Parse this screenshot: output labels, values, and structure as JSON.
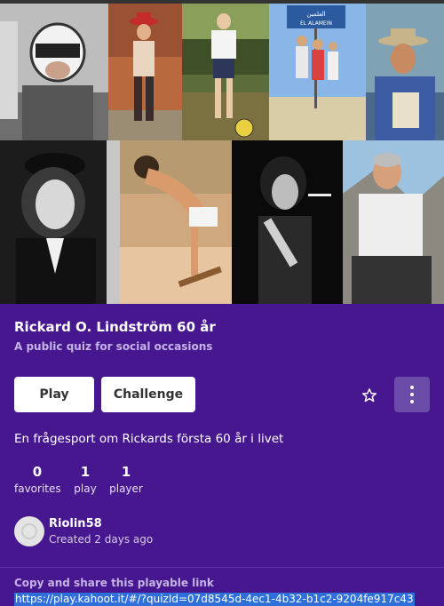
{
  "collage": {
    "photos": [
      {
        "name": "helmet-child"
      },
      {
        "name": "cowboy-child"
      },
      {
        "name": "football-boy"
      },
      {
        "name": "el-alamein-sign"
      },
      {
        "name": "hat-man"
      },
      {
        "name": "cap-portrait"
      },
      {
        "name": "skateboarder"
      },
      {
        "name": "cigarette-portrait"
      },
      {
        "name": "mountain-man"
      }
    ],
    "sign_text": "EL ALAMEIN"
  },
  "quiz": {
    "title": "Rickard O. Lindström 60 år",
    "subtitle": "A public quiz for social occasions",
    "description": "En frågesport om Rickards första 60 år i livet"
  },
  "actions": {
    "play_label": "Play",
    "challenge_label": "Challenge",
    "favorite_icon": "star-outline-icon",
    "menu_icon": "kebab-menu-icon"
  },
  "stats": {
    "favorites": {
      "value": "0",
      "label": "favorites"
    },
    "plays": {
      "value": "1",
      "label": "play"
    },
    "players": {
      "value": "1",
      "label": "player"
    }
  },
  "creator": {
    "username": "Riolin58",
    "created": "Created 2 days ago"
  },
  "share": {
    "label": "Copy and share this playable link",
    "link": "https://play.kahoot.it/#/?quizId=07d8545d-4ec1-4b32-b1c2-9204fe917c43"
  },
  "colors": {
    "background": "#46178f",
    "menu_button": "#6b4ba8",
    "link_highlight": "#2f6fd9"
  }
}
